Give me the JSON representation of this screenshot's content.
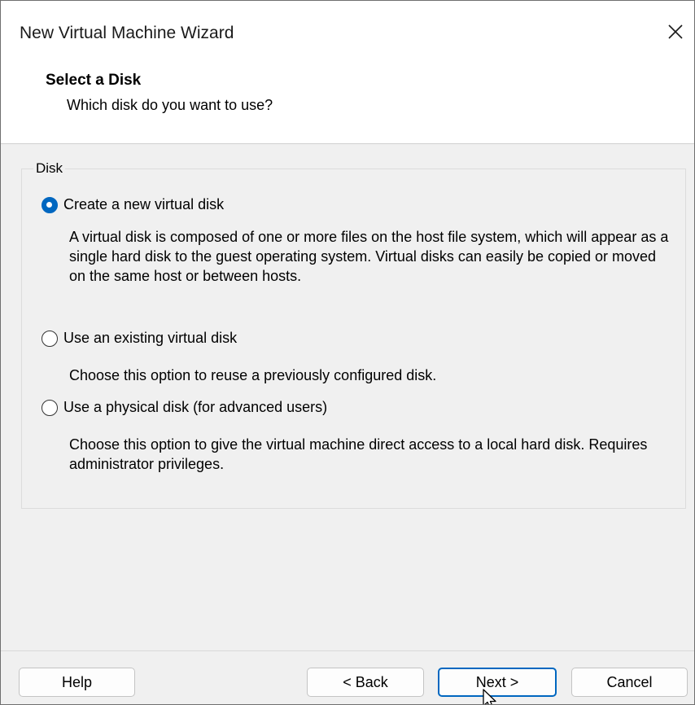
{
  "window": {
    "title": "New Virtual Machine Wizard"
  },
  "header": {
    "heading": "Select a Disk",
    "subheading": "Which disk do you want to use?"
  },
  "disk_group": {
    "legend": "Disk",
    "options": [
      {
        "label": "Create a new virtual disk",
        "selected": true,
        "description": "A virtual disk is composed of one or more files on the host file system, which will appear as a single hard disk to the guest operating system. Virtual disks can easily be copied or moved on the same host or between hosts."
      },
      {
        "label": "Use an existing virtual disk",
        "selected": false,
        "description": "Choose this option to reuse a previously configured disk."
      },
      {
        "label": "Use a physical disk (for advanced users)",
        "selected": false,
        "description": "Choose this option to give the virtual machine direct access to a local hard disk. Requires administrator privileges."
      }
    ]
  },
  "buttons": {
    "help": "Help",
    "back": "< Back",
    "next": "Next >",
    "cancel": "Cancel"
  },
  "colors": {
    "accent": "#0067c0",
    "body_background": "#f0f0f0"
  },
  "icons": {
    "close": "close-icon",
    "cursor": "mouse-cursor-icon"
  }
}
